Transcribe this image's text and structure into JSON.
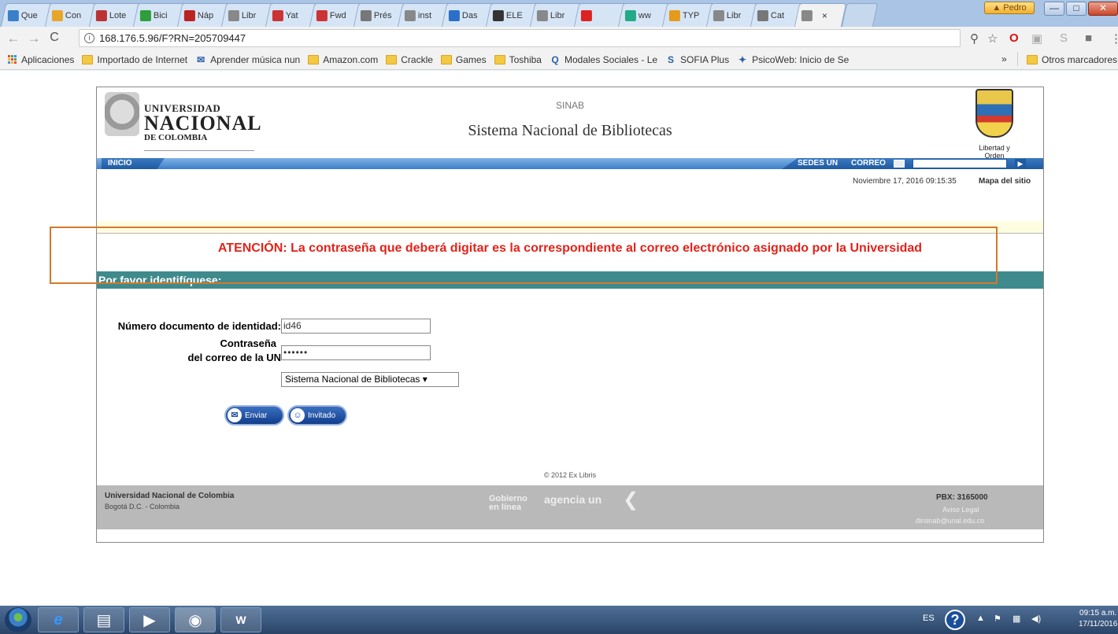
{
  "browser": {
    "tabs": [
      {
        "label": "Que",
        "icon": "lightning-icon",
        "color": "#3a7fc9"
      },
      {
        "label": "Con",
        "icon": "triangle-icon",
        "color": "#e7a62a"
      },
      {
        "label": "Lote",
        "icon": "lo-icon",
        "color": "#b33"
      },
      {
        "label": "Bici",
        "icon": "p-icon",
        "color": "#2c9e3a"
      },
      {
        "label": "Náp",
        "icon": "circle-icon",
        "color": "#b22"
      },
      {
        "label": "Libr",
        "icon": "page-icon",
        "color": "#888"
      },
      {
        "label": "Yat",
        "icon": "gmail-icon",
        "color": "#c33"
      },
      {
        "label": "Fwd",
        "icon": "gmail-icon",
        "color": "#c33"
      },
      {
        "label": "Prés",
        "icon": "library-icon",
        "color": "#777"
      },
      {
        "label": "inst",
        "icon": "page-icon",
        "color": "#888"
      },
      {
        "label": "Das",
        "icon": "help-icon",
        "color": "#2d6fc8"
      },
      {
        "label": "ELE",
        "icon": "ee-icon",
        "color": "#333"
      },
      {
        "label": "Libr",
        "icon": "page-icon",
        "color": "#888"
      },
      {
        "label": "",
        "icon": "youtube-icon",
        "color": "#d22"
      },
      {
        "label": "ww",
        "icon": "globe-icon",
        "color": "#2a8"
      },
      {
        "label": "TYP",
        "icon": "flame-icon",
        "color": "#e59a1c"
      },
      {
        "label": "Libr",
        "icon": "page-icon",
        "color": "#888"
      },
      {
        "label": "Cat",
        "icon": "library-icon",
        "color": "#777"
      },
      {
        "label": "",
        "icon": "page-icon",
        "color": "#888",
        "active": true
      }
    ],
    "profile_name": "Pedro",
    "url": "168.176.5.96/F?RN=205709447",
    "bookmarks": [
      {
        "label": "Aplicaciones",
        "icon": "apps-icon"
      },
      {
        "label": "Importado de Internet",
        "icon": "folder-icon"
      },
      {
        "label": "Aprender música nun",
        "icon": "mail-icon"
      },
      {
        "label": "Amazon.com",
        "icon": "folder-icon"
      },
      {
        "label": "Crackle",
        "icon": "folder-icon"
      },
      {
        "label": "Games",
        "icon": "folder-icon"
      },
      {
        "label": "Toshiba",
        "icon": "folder-icon"
      },
      {
        "label": "Modales Sociales - Le",
        "icon": "q-icon"
      },
      {
        "label": "SOFIA Plus",
        "icon": "s-plus-icon"
      },
      {
        "label": "PsicoWeb: Inicio de Se",
        "icon": "psico-icon"
      }
    ],
    "bookmarks_more": "»",
    "other_bookmarks": "Otros marcadores"
  },
  "site": {
    "logo_line1": "UNIVERSIDAD",
    "logo_line2": "NACIONAL",
    "logo_line3": "DE COLOMBIA",
    "sinab": "SINAB",
    "title": "Sistema Nacional de Bibliotecas",
    "shield_caption": "Libertad y Orden",
    "nav_inicio": "INICIO",
    "nav_sedes": "SEDES UN",
    "nav_correo": "CORREO",
    "datetime": "Noviembre 17, 2016 09:15:35",
    "sitemap": "Mapa del sitio",
    "attention": "ATENCIÓN: La contraseña que deberá digitar es la correspondiente al correo electrónico asignado por la Universidad",
    "identify": "Por favor identifíquese:"
  },
  "form": {
    "id_label": "Número documento de identidad:",
    "id_value": "id46",
    "pw_label1": "Contraseña",
    "pw_label2": "del correo de la UN",
    "pw_value": "••••••",
    "library_select": "Sistema Nacional de Bibliotecas ▾",
    "send_label": "Enviar",
    "guest_label": "Invitado"
  },
  "footer": {
    "copyright": "© 2012 Ex Libris",
    "univ": "Universidad Nacional de Colombia",
    "city": "Bogotá D.C. - Colombia",
    "gobierno1": "Gobierno",
    "gobierno2": "en línea",
    "agencia": "agencia un",
    "pbx": "PBX: 3165000",
    "aviso": "Aviso Legal",
    "email": "dirsinab@unal.edu.co"
  },
  "taskbar": {
    "lang": "ES",
    "time": "09:15 a.m.",
    "date": "17/11/2016"
  }
}
